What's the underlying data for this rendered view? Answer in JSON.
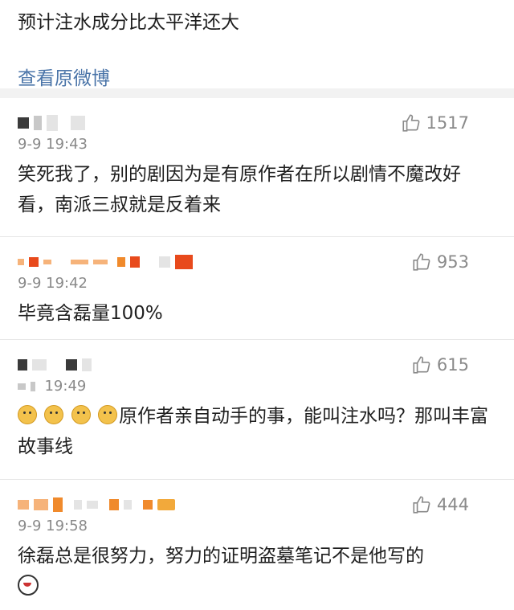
{
  "post": {
    "text": "预计注水成分比太平洋还大",
    "view_original": "查看原微博"
  },
  "comments": [
    {
      "time": "9-9 19:43",
      "likes": "1517",
      "content": "笑死我了，别的剧因为是有原作者在所以剧情不魔改好看，南派三叔就是反着来"
    },
    {
      "time": "9-9 19:42",
      "likes": "953",
      "content": "毕竟含磊量100%"
    },
    {
      "time": "19:49",
      "likes": "615",
      "content": "原作者亲自动手的事，能叫注水吗？那叫丰富故事线"
    },
    {
      "time": "9-9 19:58",
      "likes": "444",
      "content": "徐磊总是很努力，努力的证明盗墓笔记不是他写的"
    }
  ],
  "icons": {
    "like": "thumbs-up-icon",
    "emoji": "doge-emoji-icon",
    "emoji_bottom": "husky-emoji-icon"
  },
  "colors": {
    "link": "#4a74a8",
    "meta": "#8a8a8a",
    "divider": "#f2f2f2"
  }
}
